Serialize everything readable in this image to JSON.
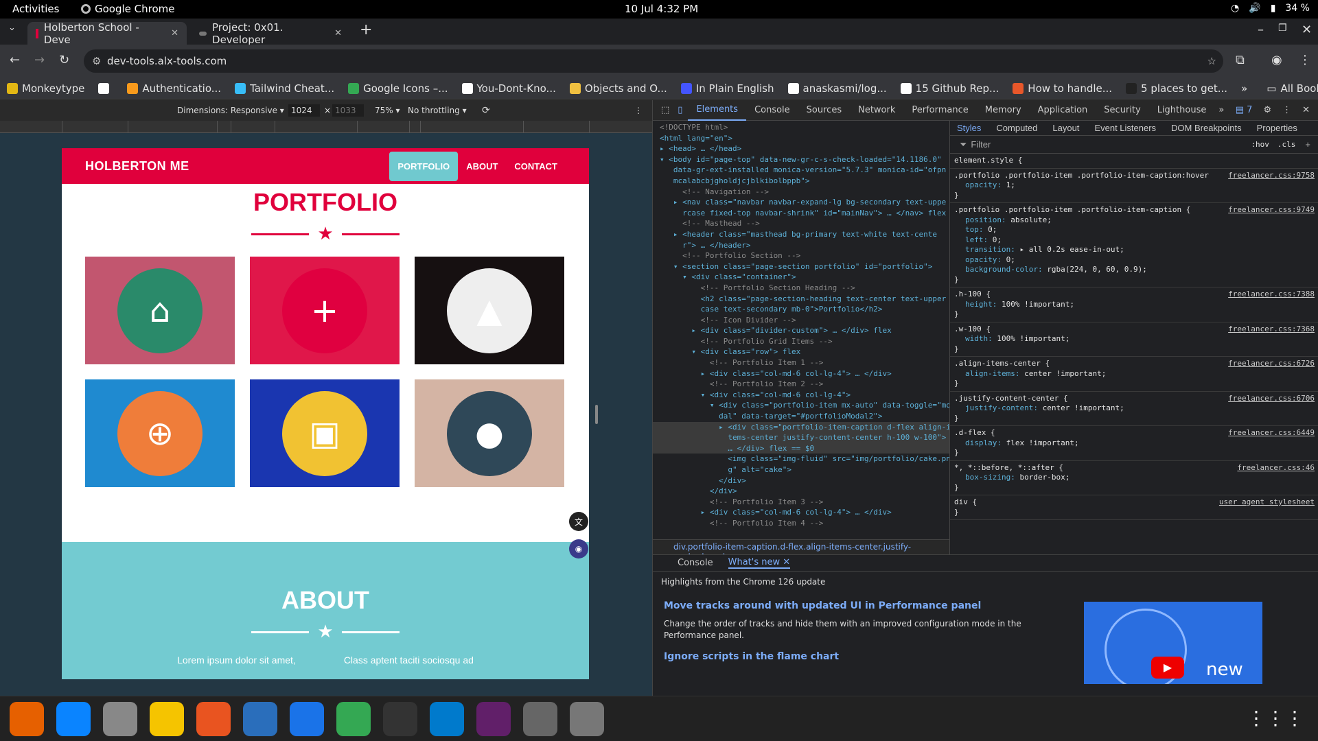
{
  "topbar": {
    "activities": "Activities",
    "app": "Google Chrome",
    "clock": "10 Jul  4:32 PM",
    "battery": "34 %"
  },
  "tabs": [
    {
      "label": "Holberton School - Deve"
    },
    {
      "label": "Project: 0x01. Developer"
    }
  ],
  "url": "dev-tools.alx-tools.com",
  "bookmarks": [
    {
      "label": "Monkeytype",
      "color": "#e2b714"
    },
    {
      "label": "",
      "color": "#fff"
    },
    {
      "label": "Authenticatio...",
      "color": "#f89a1c"
    },
    {
      "label": "Tailwind Cheat...",
      "color": "#38bdf8"
    },
    {
      "label": "Google Icons –...",
      "color": "#34a853"
    },
    {
      "label": "You-Dont-Kno...",
      "color": "#ffffff"
    },
    {
      "label": "Objects and O...",
      "color": "#f0c040"
    },
    {
      "label": "In Plain English",
      "color": "#4455ff"
    },
    {
      "label": "anaskasmi/log...",
      "color": "#ffffff"
    },
    {
      "label": "15 Github Rep...",
      "color": "#ffffff"
    },
    {
      "label": "How to handle...",
      "color": "#e8572a"
    },
    {
      "label": "5 places to get...",
      "color": "#222"
    }
  ],
  "all_bookmarks": "All Bookmarks",
  "device": {
    "dimensions": "Dimensions: Responsive ▾",
    "width": "1024",
    "height": "1033",
    "zoom": "75% ▾",
    "throttle": "No throttling ▾"
  },
  "site": {
    "brand": "HOLBERTON ME",
    "menu": [
      "PORTFOLIO",
      "ABOUT",
      "CONTACT"
    ],
    "portfolio_heading": "PORTFOLIO",
    "about_heading": "ABOUT",
    "about_col1": "Lorem ipsum dolor sit amet,",
    "about_col2": "Class aptent taciti sociosqu ad"
  },
  "portfolio": [
    {
      "bg": "#c2566f",
      "circle": "#2a8a6a",
      "icon": "cabin-icon",
      "glyph": "⌂"
    },
    {
      "bg": "#e0174a",
      "circle": "#e00040",
      "icon": "plus-icon",
      "glyph": "+"
    },
    {
      "bg": "#161011",
      "circle": "#eeeeee",
      "icon": "circus-tent-icon",
      "glyph": "▲"
    },
    {
      "bg": "#1f8ad0",
      "circle": "#ef7d3a",
      "icon": "gamepad-icon",
      "glyph": "⊕"
    },
    {
      "bg": "#1a36b0",
      "circle": "#f1c232",
      "icon": "safe-icon",
      "glyph": "▣"
    },
    {
      "bg": "#d4b4a4",
      "circle": "#2f4858",
      "icon": "submarine-icon",
      "glyph": "●"
    }
  ],
  "devtools": {
    "tabs": [
      "Elements",
      "Console",
      "Sources",
      "Network",
      "Performance",
      "Memory",
      "Application",
      "Security",
      "Lighthouse"
    ],
    "badge": "7",
    "dom": [
      {
        "t": "c",
        "s": "<!DOCTYPE html>"
      },
      {
        "t": "n",
        "s": "<html lang=\"en\">"
      },
      {
        "t": "n",
        "s": "▸ <head> … </head>"
      },
      {
        "t": "n",
        "s": "▾ <body id=\"page-top\" data-new-gr-c-s-check-loaded=\"14.1186.0\""
      },
      {
        "t": "n",
        "s": "   data-gr-ext-installed monica-version=\"5.7.3\" monica-id=\"ofpn"
      },
      {
        "t": "n",
        "s": "   mcalabcbjgholdjcjblkibolbppb\">"
      },
      {
        "t": "c",
        "s": "     <!-- Navigation -->"
      },
      {
        "t": "n",
        "s": "   ▸ <nav class=\"navbar navbar-expand-lg bg-secondary text-uppe"
      },
      {
        "t": "n",
        "s": "     rcase fixed-top navbar-shrink\" id=\"mainNav\"> … </nav> flex"
      },
      {
        "t": "c",
        "s": "     <!-- Masthead -->"
      },
      {
        "t": "n",
        "s": "   ▸ <header class=\"masthead bg-primary text-white text-cente"
      },
      {
        "t": "n",
        "s": "     r\"> … </header>"
      },
      {
        "t": "c",
        "s": "     <!-- Portfolio Section -->"
      },
      {
        "t": "n",
        "s": "   ▾ <section class=\"page-section portfolio\" id=\"portfolio\">"
      },
      {
        "t": "n",
        "s": "     ▾ <div class=\"container\">"
      },
      {
        "t": "c",
        "s": "         <!-- Portfolio Section Heading -->"
      },
      {
        "t": "n",
        "s": "         <h2 class=\"page-section-heading text-center text-upper"
      },
      {
        "t": "n",
        "s": "         case text-secondary mb-0\">Portfolio</h2>"
      },
      {
        "t": "c",
        "s": "         <!-- Icon Divider -->"
      },
      {
        "t": "n",
        "s": "       ▸ <div class=\"divider-custom\"> … </div> flex"
      },
      {
        "t": "c",
        "s": "         <!-- Portfolio Grid Items -->"
      },
      {
        "t": "n",
        "s": "       ▾ <div class=\"row\"> flex"
      },
      {
        "t": "c",
        "s": "           <!-- Portfolio Item 1 -->"
      },
      {
        "t": "n",
        "s": "         ▸ <div class=\"col-md-6 col-lg-4\"> … </div>"
      },
      {
        "t": "c",
        "s": "           <!-- Portfolio Item 2 -->"
      },
      {
        "t": "n",
        "s": "         ▾ <div class=\"col-md-6 col-lg-4\">"
      },
      {
        "t": "n",
        "s": "           ▾ <div class=\"portfolio-item mx-auto\" data-toggle=\"mo"
      },
      {
        "t": "n",
        "s": "             dal\" data-target=\"#portfolioModal2\">"
      },
      {
        "t": "s",
        "s": "             ▸ <div class=\"portfolio-item-caption d-flex align-i"
      },
      {
        "t": "s",
        "s": "               tems-center justify-content-center h-100 w-100\">"
      },
      {
        "t": "s",
        "s": "               … </div> flex == $0"
      },
      {
        "t": "n",
        "s": "               <img class=\"img-fluid\" src=\"img/portfolio/cake.pn"
      },
      {
        "t": "n",
        "s": "               g\" alt=\"cake\">"
      },
      {
        "t": "n",
        "s": "             </div>"
      },
      {
        "t": "n",
        "s": "           </div>"
      },
      {
        "t": "c",
        "s": "           <!-- Portfolio Item 3 -->"
      },
      {
        "t": "n",
        "s": "         ▸ <div class=\"col-md-6 col-lg-4\"> … </div>"
      },
      {
        "t": "c",
        "s": "           <!-- Portfolio Item 4 -->"
      }
    ],
    "breadcrumb": "div.portfolio-item-caption.d-flex.align-items-center.justify-content-cent",
    "styles_tabs": [
      "Styles",
      "Computed",
      "Layout",
      "Event Listeners",
      "DOM Breakpoints",
      "Properties"
    ],
    "filter": "Filter",
    "hov": ":hov",
    ".cls": ".cls",
    "rules": [
      {
        "sel": "element.style {",
        "src": "",
        "props": []
      },
      {
        "sel": ".portfolio .portfolio-item .portfolio-item-caption:hover",
        "src": "freelancer.css:9758",
        "props": [
          {
            "p": "opacity",
            "v": "1;"
          }
        ]
      },
      {
        "sel": ".portfolio .portfolio-item .portfolio-item-caption {",
        "src": "freelancer.css:9749",
        "props": [
          {
            "p": "position",
            "v": "absolute;"
          },
          {
            "p": "top",
            "v": "0;"
          },
          {
            "p": "left",
            "v": "0;"
          },
          {
            "p": "transition",
            "v": "▸ all 0.2s  ease-in-out;"
          },
          {
            "p": "opacity",
            "v": "0;"
          },
          {
            "p": "background-color",
            "v": "rgba(224, 0, 60, 0.9);"
          }
        ]
      },
      {
        "sel": ".h-100 {",
        "src": "freelancer.css:7388",
        "props": [
          {
            "p": "height",
            "v": "100% !important;"
          }
        ]
      },
      {
        "sel": ".w-100 {",
        "src": "freelancer.css:7368",
        "props": [
          {
            "p": "width",
            "v": "100% !important;"
          }
        ]
      },
      {
        "sel": ".align-items-center {",
        "src": "freelancer.css:6726",
        "props": [
          {
            "p": "align-items",
            "v": "center !important;"
          }
        ]
      },
      {
        "sel": ".justify-content-center {",
        "src": "freelancer.css:6706",
        "props": [
          {
            "p": "justify-content",
            "v": "center !important;"
          }
        ]
      },
      {
        "sel": ".d-flex {",
        "src": "freelancer.css:6449",
        "props": [
          {
            "p": "display",
            "v": "flex !important;"
          }
        ]
      },
      {
        "sel": "*, *::before, *::after {",
        "src": "freelancer.css:46",
        "props": [
          {
            "p": "box-sizing",
            "v": "border-box;"
          }
        ]
      },
      {
        "sel": "div {",
        "src": "user agent stylesheet",
        "props": []
      }
    ],
    "drawer_tabs": [
      "Console",
      "What's new"
    ],
    "whatsnew": {
      "highlight": "Highlights from the Chrome 126 update",
      "title1": "Move tracks around with updated UI in Performance panel",
      "desc1": "Change the order of tracks and hide them with an improved configuration mode in the Performance panel.",
      "title2": "Ignore scripts in the flame chart",
      "badge": "new"
    }
  },
  "dock": [
    {
      "icon": "firefox-icon",
      "color": "#e66000"
    },
    {
      "icon": "thunderbird-icon",
      "color": "#0a84ff"
    },
    {
      "icon": "files-icon",
      "color": "#888"
    },
    {
      "icon": "rhythmbox-icon",
      "color": "#f5c400"
    },
    {
      "icon": "app-center-icon",
      "color": "#e95420"
    },
    {
      "icon": "writer-icon",
      "color": "#2a6ebb"
    },
    {
      "icon": "help-icon",
      "color": "#1a73e8"
    },
    {
      "icon": "chrome-icon",
      "color": "#34a853"
    },
    {
      "icon": "terminal-icon",
      "color": "#333"
    },
    {
      "icon": "vscode-icon",
      "color": "#007acc"
    },
    {
      "icon": "slack-icon",
      "color": "#611f69"
    },
    {
      "icon": "disks-icon",
      "color": "#666"
    },
    {
      "icon": "trash-icon",
      "color": "#777"
    }
  ]
}
